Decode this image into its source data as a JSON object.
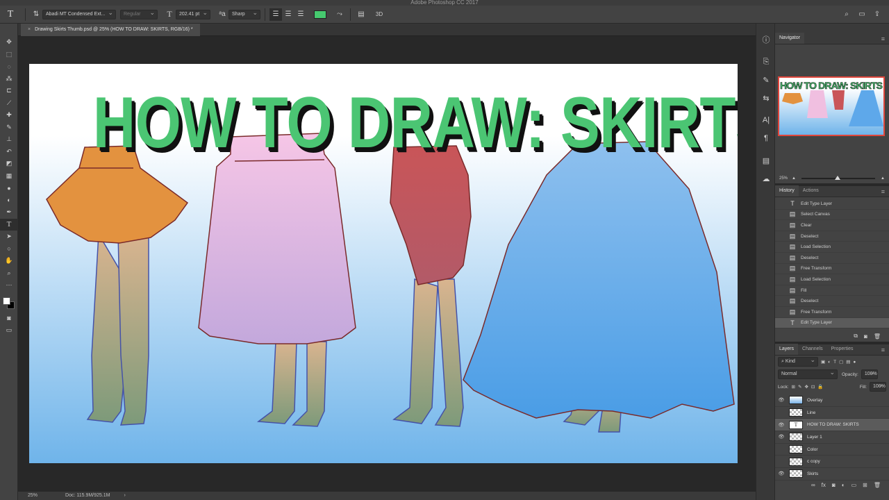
{
  "app": {
    "title": "Adobe Photoshop CC 2017"
  },
  "options": {
    "font_family": "Abadi MT Condensed Ext...",
    "font_style": "Regular",
    "font_size": "202.41 pt",
    "anti_alias": "Sharp",
    "text_color": "#46c96f"
  },
  "document": {
    "tab_label": "Drawing Skirts Thumb.psd @ 25% (HOW TO DRAW: SKIRTS, RGB/16) *",
    "headline": "HOW TO DRAW: SKIRTS"
  },
  "status": {
    "zoom": "25%",
    "doc_size": "Doc: 115.9M/925.1M"
  },
  "navigator": {
    "title": "Navigator",
    "zoom": "25%"
  },
  "history": {
    "tabs": [
      "History",
      "Actions"
    ],
    "items": [
      "Edit Type Layer",
      "Select Canvas",
      "Clear",
      "Deselect",
      "Load Selection",
      "Deselect",
      "Free Transform",
      "Load Selection",
      "Fill",
      "Deselect",
      "Free Transform",
      "Edit Type Layer"
    ]
  },
  "layers": {
    "tabs": [
      "Layers",
      "Channels",
      "Properties"
    ],
    "kind_label": "Kind",
    "blend_mode": "Normal",
    "opacity_label": "Opacity:",
    "opacity": "100%",
    "lock_label": "Lock:",
    "fill_label": "Fill:",
    "fill": "100%",
    "items": [
      {
        "name": "Overlay",
        "visible": true
      },
      {
        "name": "Line",
        "visible": false
      },
      {
        "name": "HOW TO DRAW: SKIRTS",
        "visible": true
      },
      {
        "name": "Layer 1",
        "visible": true
      },
      {
        "name": "Color",
        "visible": false
      },
      {
        "name": "c copy",
        "visible": false
      },
      {
        "name": "Skirts",
        "visible": true
      }
    ]
  }
}
